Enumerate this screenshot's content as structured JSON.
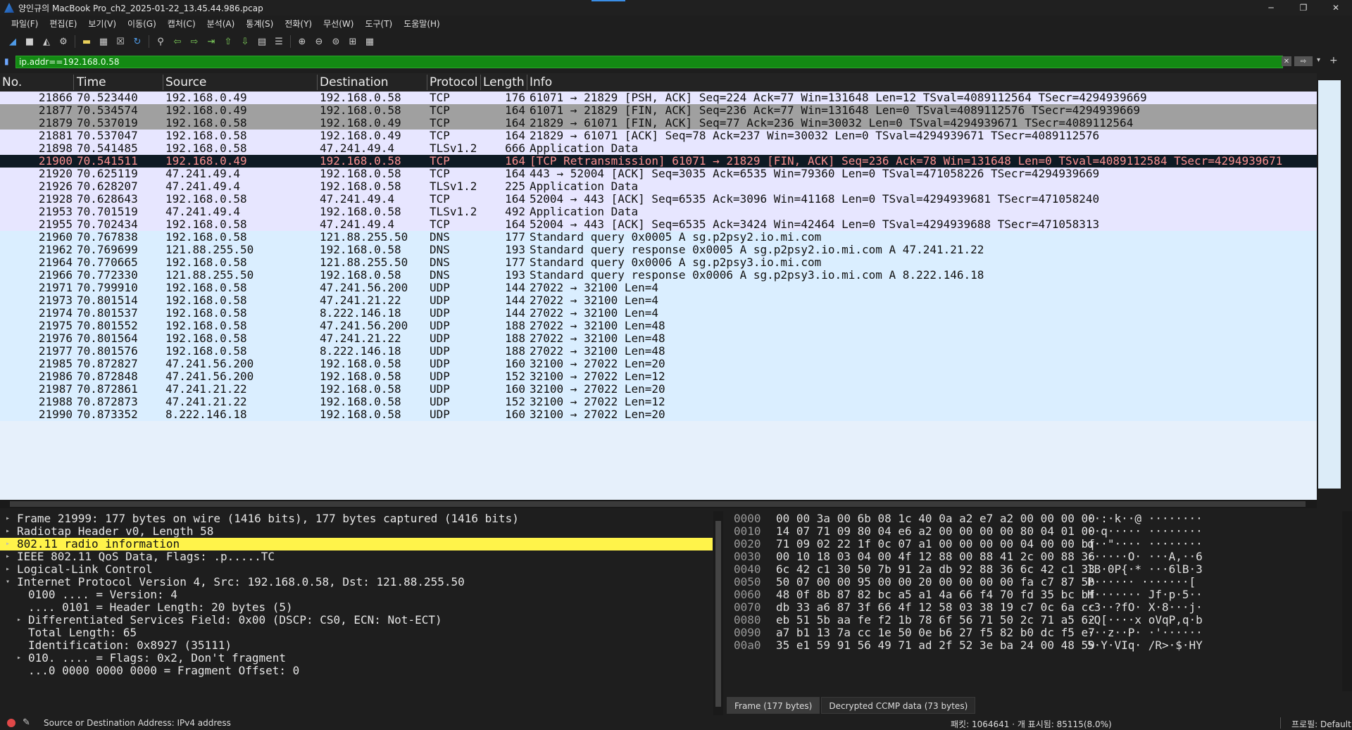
{
  "window": {
    "title": "양인규의 MacBook Pro_ch2_2025-01-22_13.45.44.986.pcap",
    "minimize": "─",
    "restore": "❐",
    "close": "✕"
  },
  "menu": [
    "파일(F)",
    "편집(E)",
    "보기(V)",
    "이동(G)",
    "캡처(C)",
    "분석(A)",
    "통계(S)",
    "전화(Y)",
    "무선(W)",
    "도구(T)",
    "도움말(H)"
  ],
  "toolbar": {
    "icons": [
      {
        "name": "shark-fin-start-icon",
        "glyph": "◢",
        "color": "blue"
      },
      {
        "name": "stop-capture-icon",
        "glyph": "■",
        "color": "gray"
      },
      {
        "name": "restart-capture-icon",
        "glyph": "◭",
        "color": "gray"
      },
      {
        "name": "capture-options-icon",
        "glyph": "⚙",
        "color": "gray"
      },
      {
        "sep": true
      },
      {
        "name": "open-file-icon",
        "glyph": "▬",
        "color": "yellow"
      },
      {
        "name": "save-file-icon",
        "glyph": "▦",
        "color": "gray"
      },
      {
        "name": "close-file-icon",
        "glyph": "☒",
        "color": "gray"
      },
      {
        "name": "reload-file-icon",
        "glyph": "↻",
        "color": "blue"
      },
      {
        "sep": true
      },
      {
        "name": "find-packet-icon",
        "glyph": "⚲",
        "color": "gray"
      },
      {
        "name": "go-back-icon",
        "glyph": "⇦",
        "color": "green"
      },
      {
        "name": "go-forward-icon",
        "glyph": "⇨",
        "color": "green"
      },
      {
        "name": "go-to-packet-icon",
        "glyph": "⇥",
        "color": "green"
      },
      {
        "name": "go-first-icon",
        "glyph": "⇧",
        "color": "green"
      },
      {
        "name": "go-last-icon",
        "glyph": "⇩",
        "color": "green"
      },
      {
        "name": "auto-scroll-icon",
        "glyph": "▤",
        "color": "gray"
      },
      {
        "name": "colorize-icon",
        "glyph": "☰",
        "color": "gray"
      },
      {
        "sep": true
      },
      {
        "name": "zoom-in-icon",
        "glyph": "⊕",
        "color": "gray"
      },
      {
        "name": "zoom-out-icon",
        "glyph": "⊖",
        "color": "gray"
      },
      {
        "name": "zoom-reset-icon",
        "glyph": "⊜",
        "color": "gray"
      },
      {
        "name": "resize-columns-icon",
        "glyph": "⊞",
        "color": "gray"
      },
      {
        "name": "layout-icon",
        "glyph": "▦",
        "color": "gray"
      }
    ]
  },
  "filter": {
    "value": "ip.addr==192.168.0.58",
    "clear_label": "✕",
    "apply_label": "⇨",
    "dropdown_label": "▾",
    "plus_label": "+"
  },
  "colors": {
    "tcp_row": "#e7e6ff",
    "tcp_fin_row": "#a0a0a0",
    "udp_row": "#daeeff",
    "tls_row": "#e7e6ff",
    "dns_row": "#daeeff",
    "selected_row_bg": "#0e1a24",
    "selected_row_fg": "#f78f8f",
    "filter_ok_bg": "#138a13",
    "highlight_yellow": "#fff34a"
  },
  "packet_columns": [
    "No.",
    "Time",
    "Source",
    "Destination",
    "Protocol",
    "Length",
    "Info"
  ],
  "packets": [
    {
      "no": "21866",
      "time": "70.523440",
      "src": "192.168.0.49",
      "dst": "192.168.0.58",
      "proto": "TCP",
      "len": "176",
      "info": "61071 → 21829 [PSH, ACK] Seq=224 Ack=77 Win=131648 Len=12 TSval=4089112564 TSecr=4294939669",
      "style": "tcp_row"
    },
    {
      "no": "21877",
      "time": "70.534574",
      "src": "192.168.0.49",
      "dst": "192.168.0.58",
      "proto": "TCP",
      "len": "164",
      "info": "61071 → 21829 [FIN, ACK] Seq=236 Ack=77 Win=131648 Len=0 TSval=4089112576 TSecr=4294939669",
      "style": "tcp_fin_row"
    },
    {
      "no": "21879",
      "time": "70.537019",
      "src": "192.168.0.58",
      "dst": "192.168.0.49",
      "proto": "TCP",
      "len": "164",
      "info": "21829 → 61071 [FIN, ACK] Seq=77 Ack=236 Win=30032 Len=0 TSval=4294939671 TSecr=4089112564",
      "style": "tcp_fin_row"
    },
    {
      "no": "21881",
      "time": "70.537047",
      "src": "192.168.0.58",
      "dst": "192.168.0.49",
      "proto": "TCP",
      "len": "164",
      "info": "21829 → 61071 [ACK] Seq=78 Ack=237 Win=30032 Len=0 TSval=4294939671 TSecr=4089112576",
      "style": "tcp_row"
    },
    {
      "no": "21898",
      "time": "70.541485",
      "src": "192.168.0.58",
      "dst": "47.241.49.4",
      "proto": "TLSv1.2",
      "len": "666",
      "info": "Application Data",
      "style": "tls_row"
    },
    {
      "no": "21900",
      "time": "70.541511",
      "src": "192.168.0.49",
      "dst": "192.168.0.58",
      "proto": "TCP",
      "len": "164",
      "info": "[TCP Retransmission] 61071 → 21829 [FIN, ACK] Seq=236 Ack=78 Win=131648 Len=0 TSval=4089112584 TSecr=4294939671",
      "style": "selected"
    },
    {
      "no": "21920",
      "time": "70.625119",
      "src": "47.241.49.4",
      "dst": "192.168.0.58",
      "proto": "TCP",
      "len": "164",
      "info": "443 → 52004 [ACK] Seq=3035 Ack=6535 Win=79360 Len=0 TSval=471058226 TSecr=4294939669",
      "style": "tcp_row"
    },
    {
      "no": "21926",
      "time": "70.628207",
      "src": "47.241.49.4",
      "dst": "192.168.0.58",
      "proto": "TLSv1.2",
      "len": "225",
      "info": "Application Data",
      "style": "tls_row"
    },
    {
      "no": "21928",
      "time": "70.628643",
      "src": "192.168.0.58",
      "dst": "47.241.49.4",
      "proto": "TCP",
      "len": "164",
      "info": "52004 → 443 [ACK] Seq=6535 Ack=3096 Win=41168 Len=0 TSval=4294939681 TSecr=471058240",
      "style": "tcp_row"
    },
    {
      "no": "21953",
      "time": "70.701519",
      "src": "47.241.49.4",
      "dst": "192.168.0.58",
      "proto": "TLSv1.2",
      "len": "492",
      "info": "Application Data",
      "style": "tls_row"
    },
    {
      "no": "21955",
      "time": "70.702434",
      "src": "192.168.0.58",
      "dst": "47.241.49.4",
      "proto": "TCP",
      "len": "164",
      "info": "52004 → 443 [ACK] Seq=6535 Ack=3424 Win=42464 Len=0 TSval=4294939688 TSecr=471058313",
      "style": "tcp_row"
    },
    {
      "no": "21960",
      "time": "70.767838",
      "src": "192.168.0.58",
      "dst": "121.88.255.50",
      "proto": "DNS",
      "len": "177",
      "info": "Standard query 0x0005 A sg.p2psy2.io.mi.com",
      "style": "dns_row"
    },
    {
      "no": "21962",
      "time": "70.769699",
      "src": "121.88.255.50",
      "dst": "192.168.0.58",
      "proto": "DNS",
      "len": "193",
      "info": "Standard query response 0x0005 A sg.p2psy2.io.mi.com A 47.241.21.22",
      "style": "dns_row"
    },
    {
      "no": "21964",
      "time": "70.770665",
      "src": "192.168.0.58",
      "dst": "121.88.255.50",
      "proto": "DNS",
      "len": "177",
      "info": "Standard query 0x0006 A sg.p2psy3.io.mi.com",
      "style": "dns_row"
    },
    {
      "no": "21966",
      "time": "70.772330",
      "src": "121.88.255.50",
      "dst": "192.168.0.58",
      "proto": "DNS",
      "len": "193",
      "info": "Standard query response 0x0006 A sg.p2psy3.io.mi.com A 8.222.146.18",
      "style": "dns_row"
    },
    {
      "no": "21971",
      "time": "70.799910",
      "src": "192.168.0.58",
      "dst": "47.241.56.200",
      "proto": "UDP",
      "len": "144",
      "info": "27022 → 32100 Len=4",
      "style": "udp_row"
    },
    {
      "no": "21973",
      "time": "70.801514",
      "src": "192.168.0.58",
      "dst": "47.241.21.22",
      "proto": "UDP",
      "len": "144",
      "info": "27022 → 32100 Len=4",
      "style": "udp_row"
    },
    {
      "no": "21974",
      "time": "70.801537",
      "src": "192.168.0.58",
      "dst": "8.222.146.18",
      "proto": "UDP",
      "len": "144",
      "info": "27022 → 32100 Len=4",
      "style": "udp_row"
    },
    {
      "no": "21975",
      "time": "70.801552",
      "src": "192.168.0.58",
      "dst": "47.241.56.200",
      "proto": "UDP",
      "len": "188",
      "info": "27022 → 32100 Len=48",
      "style": "udp_row"
    },
    {
      "no": "21976",
      "time": "70.801564",
      "src": "192.168.0.58",
      "dst": "47.241.21.22",
      "proto": "UDP",
      "len": "188",
      "info": "27022 → 32100 Len=48",
      "style": "udp_row"
    },
    {
      "no": "21977",
      "time": "70.801576",
      "src": "192.168.0.58",
      "dst": "8.222.146.18",
      "proto": "UDP",
      "len": "188",
      "info": "27022 → 32100 Len=48",
      "style": "udp_row"
    },
    {
      "no": "21985",
      "time": "70.872827",
      "src": "47.241.56.200",
      "dst": "192.168.0.58",
      "proto": "UDP",
      "len": "160",
      "info": "32100 → 27022 Len=20",
      "style": "udp_row"
    },
    {
      "no": "21986",
      "time": "70.872848",
      "src": "47.241.56.200",
      "dst": "192.168.0.58",
      "proto": "UDP",
      "len": "152",
      "info": "32100 → 27022 Len=12",
      "style": "udp_row"
    },
    {
      "no": "21987",
      "time": "70.872861",
      "src": "47.241.21.22",
      "dst": "192.168.0.58",
      "proto": "UDP",
      "len": "160",
      "info": "32100 → 27022 Len=20",
      "style": "udp_row"
    },
    {
      "no": "21988",
      "time": "70.872873",
      "src": "47.241.21.22",
      "dst": "192.168.0.58",
      "proto": "UDP",
      "len": "152",
      "info": "32100 → 27022 Len=12",
      "style": "udp_row"
    },
    {
      "no": "21990",
      "time": "70.873352",
      "src": "8.222.146.18",
      "dst": "192.168.0.58",
      "proto": "UDP",
      "len": "160",
      "info": "32100 → 27022 Len=20",
      "style": "udp_row"
    }
  ],
  "details": [
    {
      "indent": 0,
      "arrow": "▸",
      "text": "Frame 21999: 177 bytes on wire (1416 bits), 177 bytes captured (1416 bits)"
    },
    {
      "indent": 0,
      "arrow": "▸",
      "text": "Radiotap Header v0, Length 58"
    },
    {
      "indent": 0,
      "arrow": "▸",
      "text": "802.11 radio information",
      "highlight": true
    },
    {
      "indent": 0,
      "arrow": "▸",
      "text": "IEEE 802.11 QoS Data, Flags: .p.....TC"
    },
    {
      "indent": 0,
      "arrow": "▸",
      "text": "Logical-Link Control"
    },
    {
      "indent": 0,
      "arrow": "▾",
      "text": "Internet Protocol Version 4, Src: 192.168.0.58, Dst: 121.88.255.50"
    },
    {
      "indent": 1,
      "arrow": "",
      "text": "0100 .... = Version: 4"
    },
    {
      "indent": 1,
      "arrow": "",
      "text": ".... 0101 = Header Length: 20 bytes (5)"
    },
    {
      "indent": 1,
      "arrow": "▸",
      "text": "Differentiated Services Field: 0x00 (DSCP: CS0, ECN: Not-ECT)"
    },
    {
      "indent": 1,
      "arrow": "",
      "text": "Total Length: 65"
    },
    {
      "indent": 1,
      "arrow": "",
      "text": "Identification: 0x8927 (35111)"
    },
    {
      "indent": 1,
      "arrow": "▸",
      "text": "010. .... = Flags: 0x2, Don't fragment"
    },
    {
      "indent": 1,
      "arrow": "",
      "text": "...0 0000 0000 0000 = Fragment Offset: 0"
    }
  ],
  "bytes": [
    {
      "off": "0000",
      "hex": "00 00 3a 00 6b 08 1c 40  0a a2 e7 a2 00 00 00 00",
      "ascii": "··:·k··@ ········"
    },
    {
      "off": "0010",
      "hex": "14 07 71 09 80 04 e6 a2  00 00 00 00 80 04 01 00",
      "ascii": "··q····· ········"
    },
    {
      "off": "0020",
      "hex": "71 09 02 22 1f 0c 07 a1  00 00 00 00 04 00 00 bf",
      "ascii": "q··\"···· ········"
    },
    {
      "off": "0030",
      "hex": "00 10 18 03 04 00 4f 12  88 00 88 41 2c 00 88 36",
      "ascii": "······O· ···A,··6"
    },
    {
      "off": "0040",
      "hex": "6c 42 c1 30 50 7b 91 2a  db 92 88 36 6c 42 c1 33",
      "ascii": "lB·0P{·* ···6lB·3"
    },
    {
      "off": "0050",
      "hex": "50 07 00 00 95 00 00 20  00 00 00 00 fa c7 87 5b",
      "ascii": "P······  ·······["
    },
    {
      "off": "0060",
      "hex": "48 0f 8b 87 82 bc a5 a1  4a 66 f4 70 fd 35 bc bf",
      "ascii": "H······· Jf·p·5··"
    },
    {
      "off": "0070",
      "hex": "db 33 a6 87 3f 66 4f 12  58 03 38 19 c7 0c 6a cc",
      "ascii": "·3··?fO· X·8···j·"
    },
    {
      "off": "0080",
      "hex": "eb 51 5b aa fe f2 1b 78  6f 56 71 50 2c 71 a5 62",
      "ascii": "·Q[····x oVqP,q·b"
    },
    {
      "off": "0090",
      "hex": "a7 b1 13 7a cc 1e 50 0e  b6 27 f5 82 b0 dc f5 e7",
      "ascii": "···z··P· ·'······"
    },
    {
      "off": "00a0",
      "hex": "35 e1 59 91 56 49 71 ad  2f 52 3e ba 24 00 48 59",
      "ascii": "5·Y·VIq· /R>·$·HY"
    }
  ],
  "byte_tabs": [
    "Frame (177 bytes)",
    "Decrypted CCMP data (73 bytes)"
  ],
  "status": {
    "field": "Source or Destination Address: IPv4 address",
    "packets": "패킷: 1064641 · 개 표시됨: 85115(8.0%)",
    "profile": "프로필: Default"
  }
}
